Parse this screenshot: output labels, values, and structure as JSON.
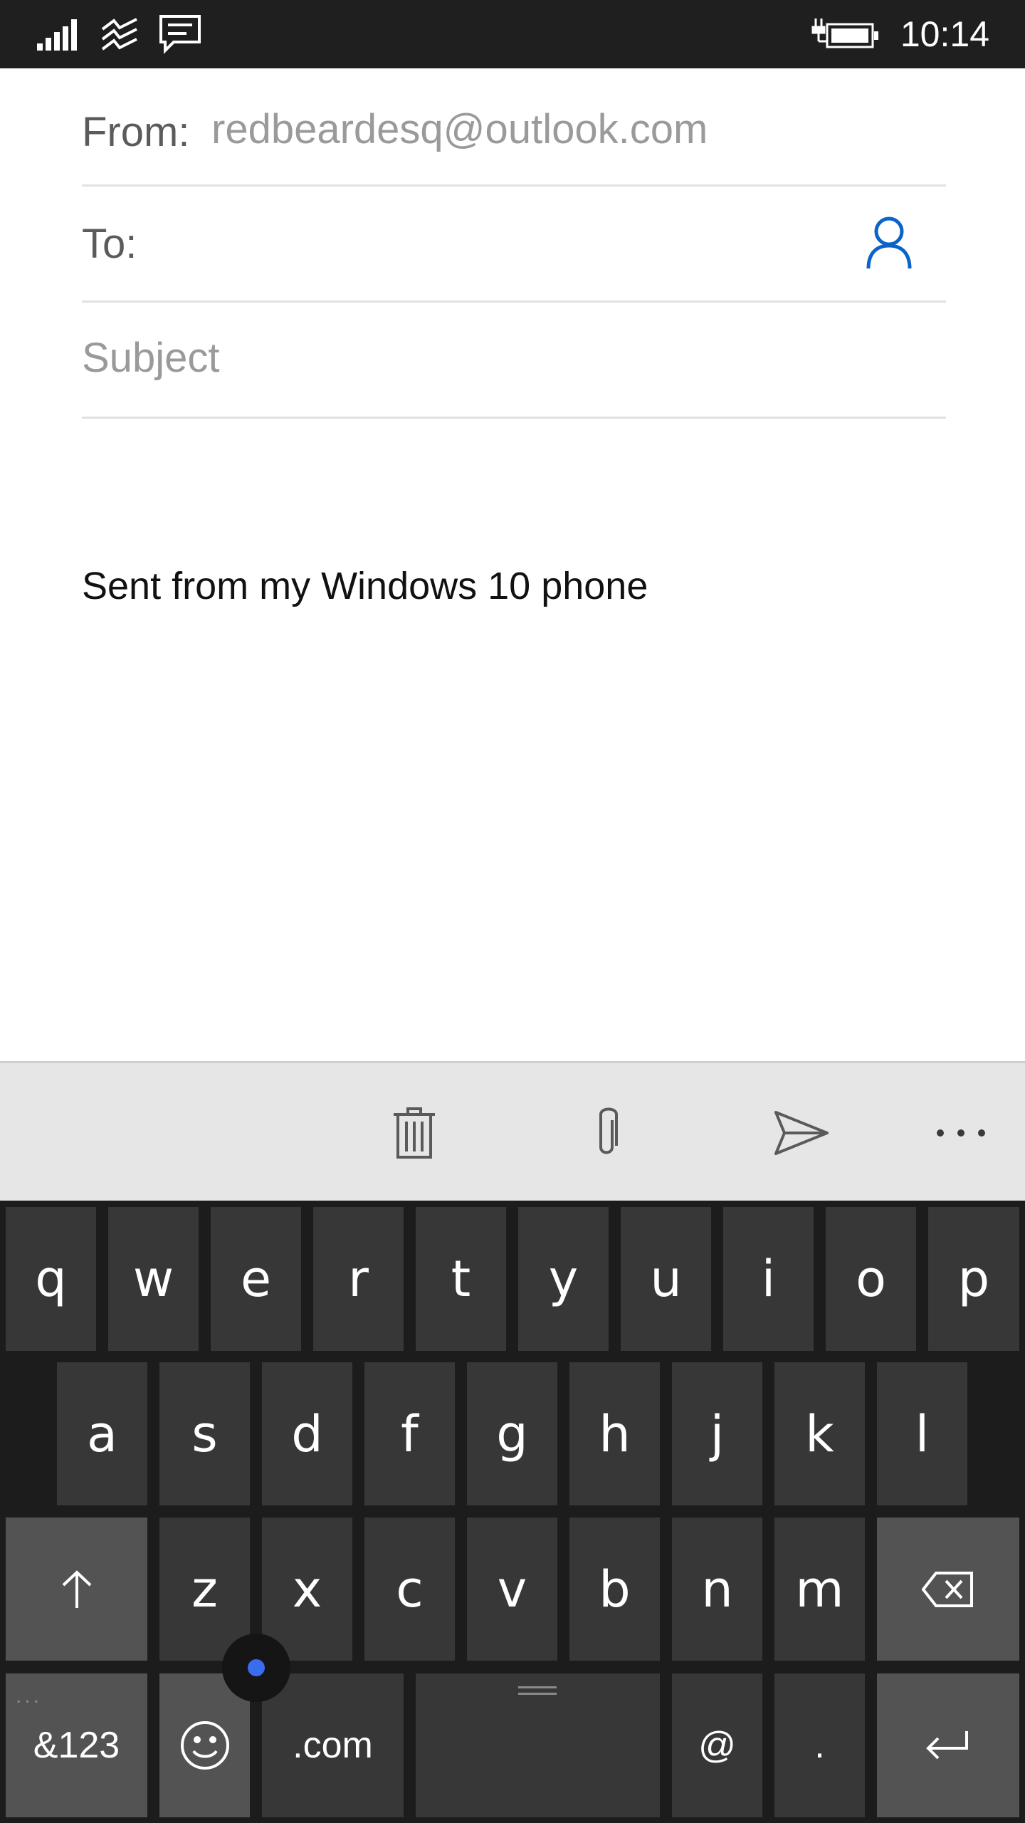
{
  "status_bar": {
    "time": "10:14",
    "icons": [
      "signal-icon",
      "wifi-icon",
      "message-icon",
      "battery-charging-icon"
    ]
  },
  "compose": {
    "from_label": "From:",
    "from_value": "redbeardesq@outlook.com",
    "to_label": "To:",
    "to_value": "",
    "subject_placeholder": "Subject",
    "subject_value": "",
    "body": "Sent from my Windows 10 phone"
  },
  "command_bar": {
    "icons": [
      "delete-icon",
      "attach-icon",
      "send-icon",
      "more-icon"
    ],
    "more_label": "..."
  },
  "keyboard": {
    "row1": [
      "q",
      "w",
      "e",
      "r",
      "t",
      "y",
      "u",
      "i",
      "o",
      "p"
    ],
    "row2": [
      "a",
      "s",
      "d",
      "f",
      "g",
      "h",
      "j",
      "k",
      "l"
    ],
    "row3": [
      "z",
      "x",
      "c",
      "v",
      "b",
      "n",
      "m"
    ],
    "symbols_label": "&123",
    "dotcom_label": ".com",
    "at_label": "@",
    "period_label": ".",
    "more_hint": "..."
  },
  "colors": {
    "status_bar_bg": "#1f1f1f",
    "accent": "#0a64c8",
    "keyboard_bg": "#1c1c1c",
    "key_bg": "#373737",
    "special_key_bg": "#535353",
    "cursor_dot": "#3a6cf0"
  }
}
